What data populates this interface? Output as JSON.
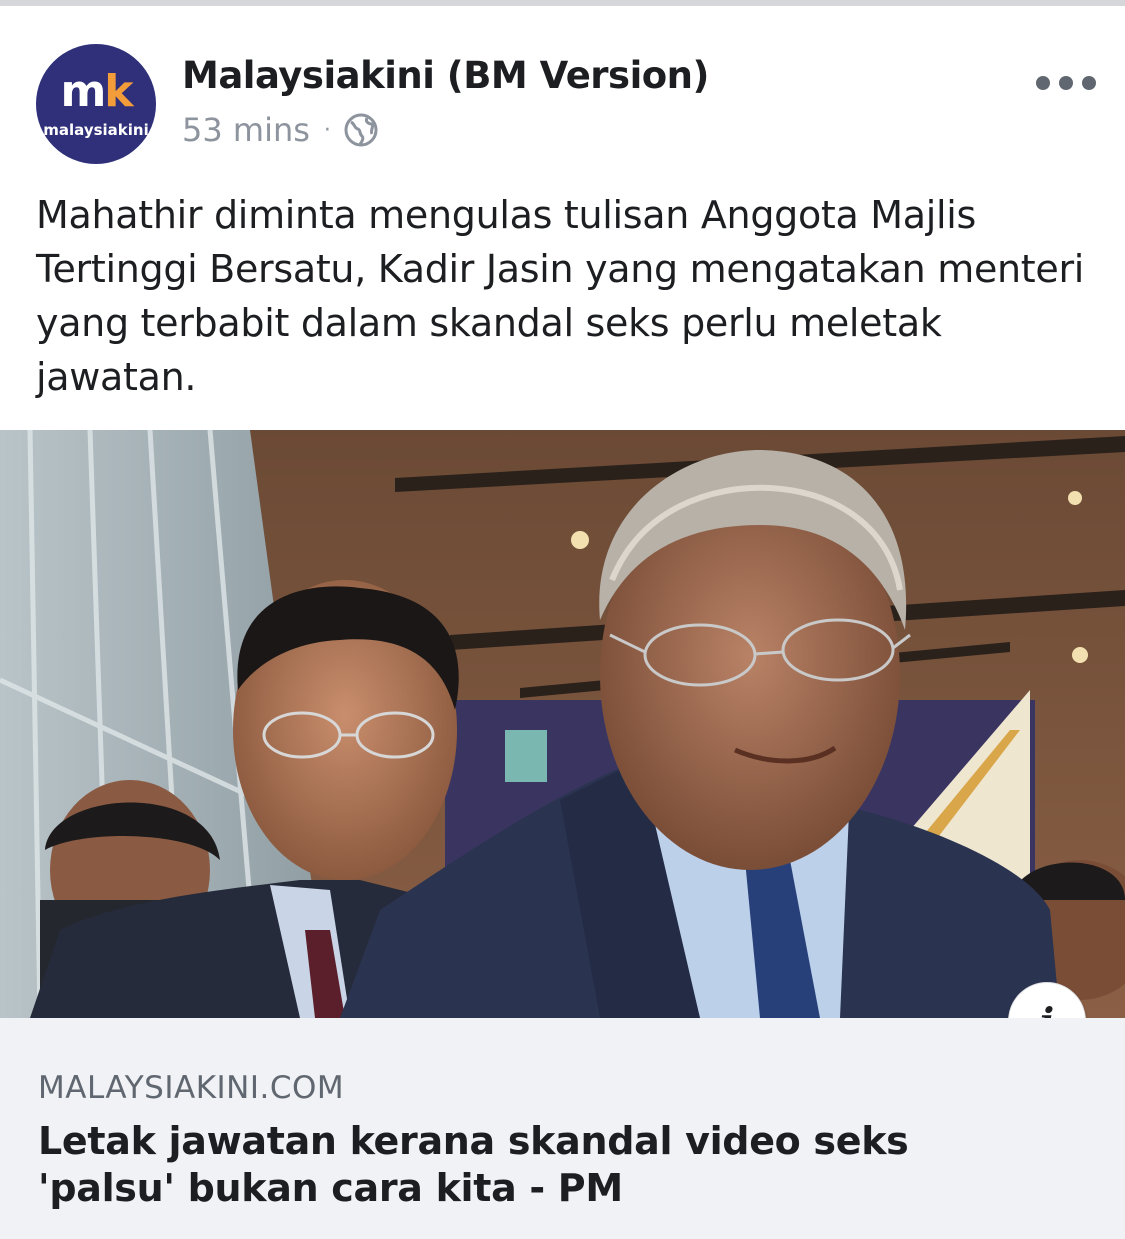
{
  "topbar": {},
  "post": {
    "page_name": "Malaysiakini (BM Version)",
    "avatar": {
      "logo_letters": "m",
      "logo_accent": "k",
      "logo_text": "malaysiakini"
    },
    "timestamp": "53 mins",
    "separator": "·",
    "audience_icon": "globe-icon",
    "more_icon": "more-options-icon",
    "text": "Mahathir diminta mengulas tulisan Anggota Majlis Tertinggi Bersatu, Kadir Jasin yang mengatakan menteri yang terbabit dalam skandal seks perlu meletak jawatan."
  },
  "link_preview": {
    "info_icon": "info-icon",
    "info_glyph": "i",
    "domain": "MALAYSIAKINI.COM",
    "title": "Letak jawatan kerana skandal video seks 'palsu' bukan cara kita - PM"
  },
  "colors": {
    "brand_navy": "#2f2f7a",
    "brand_orange": "#f39c3a",
    "text_primary": "#1c1e21",
    "text_secondary": "#8d949e",
    "link_bg": "#f0f2f5"
  }
}
